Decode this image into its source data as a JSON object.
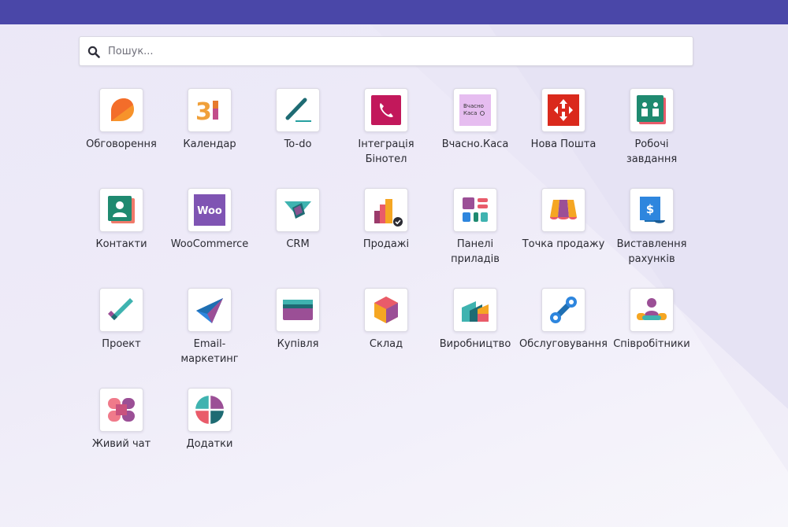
{
  "search": {
    "placeholder": "Пошук..."
  },
  "apps": [
    {
      "label": "Обговорення",
      "icon": "discuss-icon"
    },
    {
      "label": "Календар",
      "icon": "calendar-icon"
    },
    {
      "label": "To-do",
      "icon": "todo-icon"
    },
    {
      "label": "Інтеграція\nБінотел",
      "icon": "binotel-icon"
    },
    {
      "label": "Вчасно.Каса",
      "icon": "vchasno-kasa-icon",
      "icon_text": "Вчасно\nКаса"
    },
    {
      "label": "Нова Пошта",
      "icon": "nova-poshta-icon"
    },
    {
      "label": "Робочі\nзавдання",
      "icon": "worksheet-icon"
    },
    {
      "label": "Контакти",
      "icon": "contacts-icon"
    },
    {
      "label": "WooCommerce",
      "icon": "woocommerce-icon",
      "icon_text": "Woo"
    },
    {
      "label": "CRM",
      "icon": "crm-icon"
    },
    {
      "label": "Продажі",
      "icon": "sales-icon"
    },
    {
      "label": "Панелі\nприладів",
      "icon": "dashboards-icon"
    },
    {
      "label": "Точка продажу",
      "icon": "point-of-sale-icon"
    },
    {
      "label": "Виставлення\nрахунків",
      "icon": "invoicing-icon"
    },
    {
      "label": "Проект",
      "icon": "project-icon"
    },
    {
      "label": "Email-\nмаркетинг",
      "icon": "email-marketing-icon"
    },
    {
      "label": "Купівля",
      "icon": "purchase-icon"
    },
    {
      "label": "Склад",
      "icon": "inventory-icon"
    },
    {
      "label": "Виробництво",
      "icon": "manufacturing-icon"
    },
    {
      "label": "Обслуговування",
      "icon": "maintenance-icon"
    },
    {
      "label": "Співробітники",
      "icon": "employees-icon"
    },
    {
      "label": "Живий чат",
      "icon": "live-chat-icon"
    },
    {
      "label": "Додатки",
      "icon": "apps-icon"
    }
  ],
  "colors": {
    "topbar": "#4a47a8",
    "background": "#ebe8f7"
  }
}
